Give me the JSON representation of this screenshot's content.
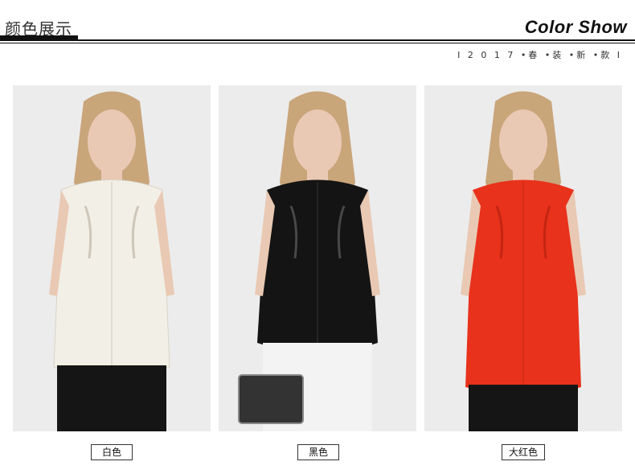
{
  "header": {
    "title_cn": "颜色展示",
    "title_en": "Color Show",
    "subtitle": "I 2 0 1 7 •春 •装 •新 •款 I"
  },
  "products": [
    {
      "caption": "白色",
      "shirt_color": "#f2efe6"
    },
    {
      "caption": "黑色",
      "shirt_color": "#141414"
    },
    {
      "caption": "大红色",
      "shirt_color": "#e8321c"
    }
  ],
  "colors": {
    "panel_bg": "#ececec",
    "hair": "#c9a57a",
    "skin": "#e9c9b4",
    "pants": "#151515"
  }
}
